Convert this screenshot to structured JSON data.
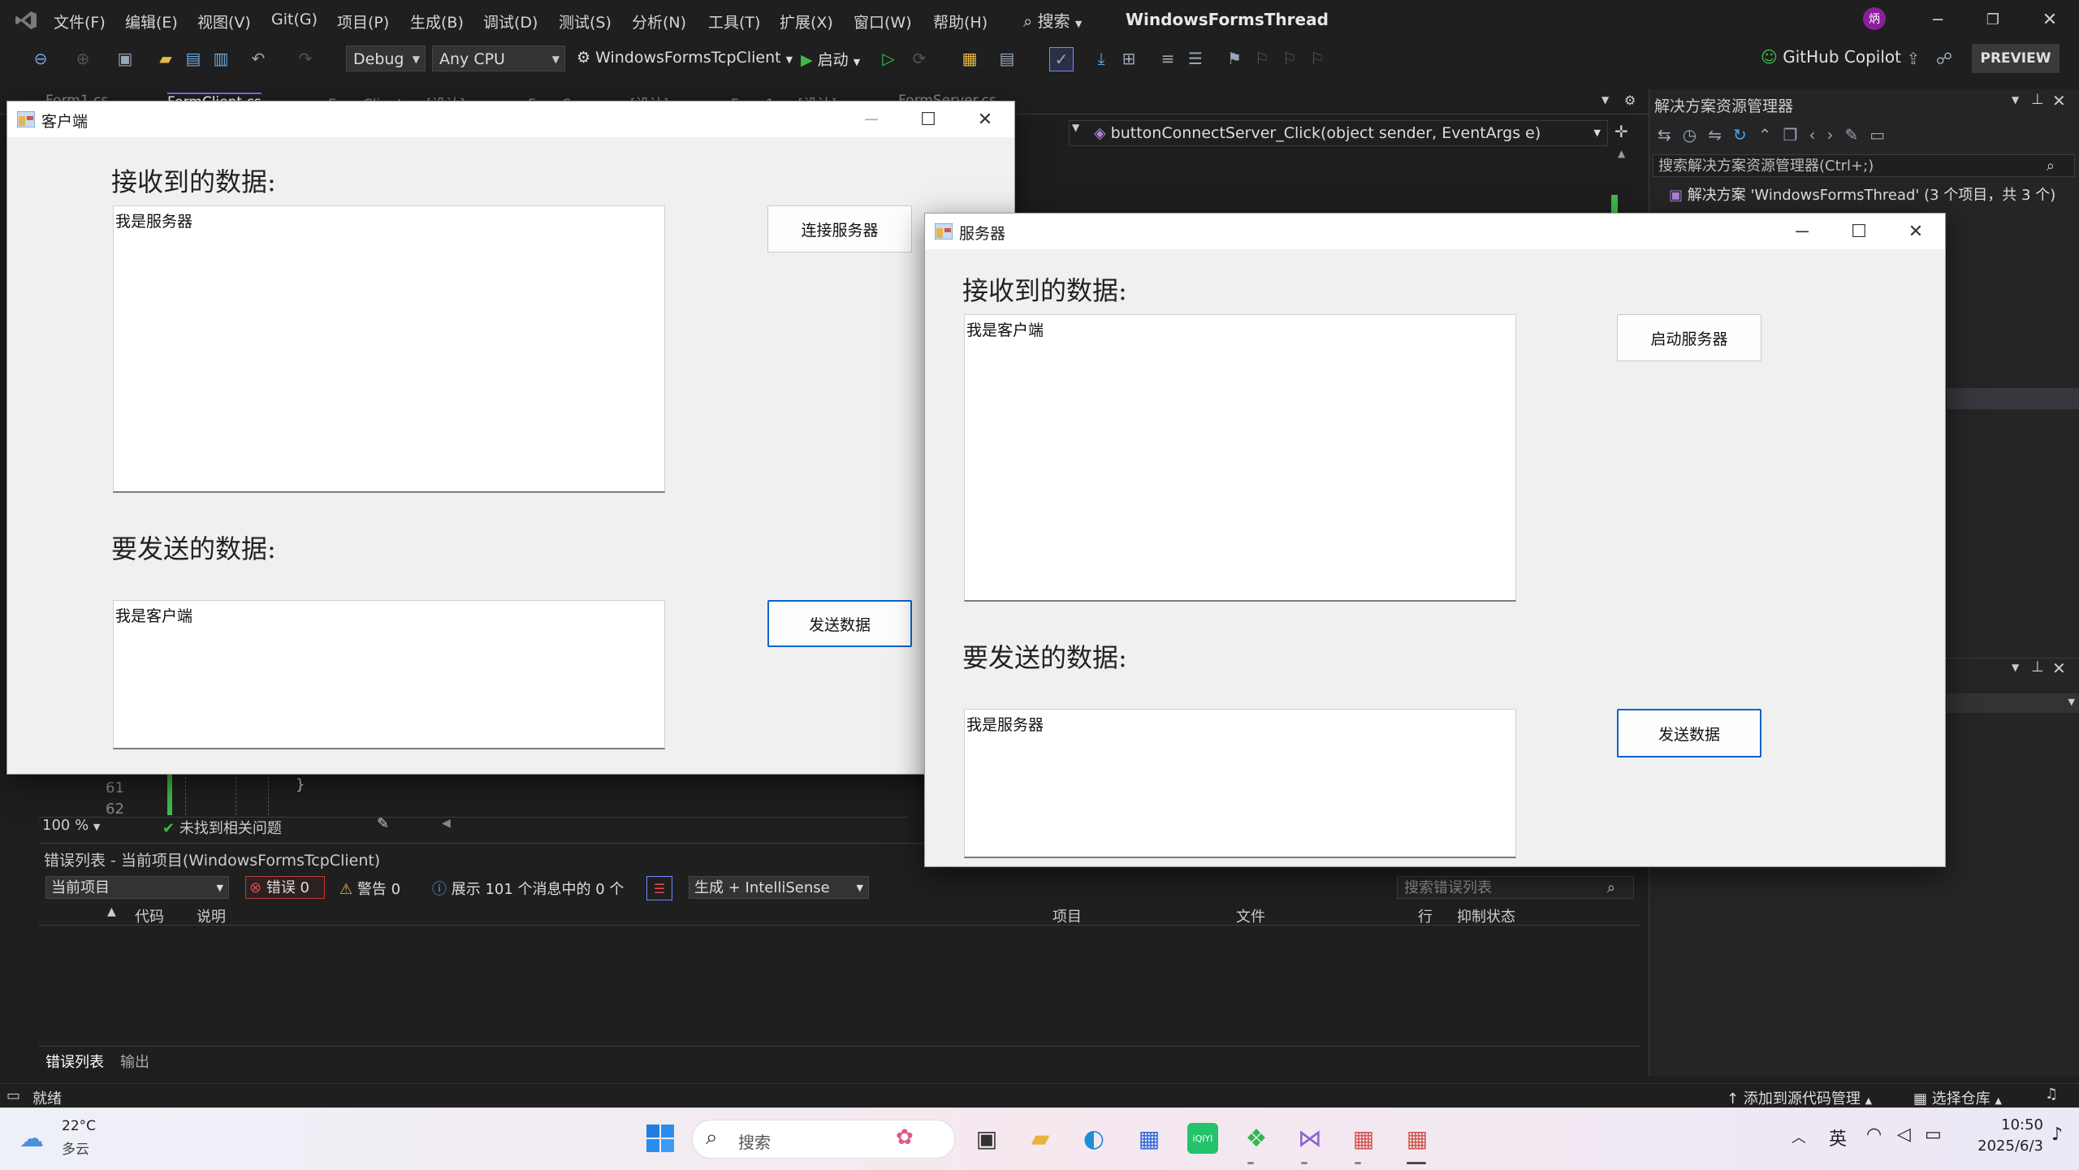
{
  "vs": {
    "menu": [
      "文件(F)",
      "编辑(E)",
      "视图(V)",
      "Git(G)",
      "项目(P)",
      "生成(B)",
      "调试(D)",
      "测试(S)",
      "分析(N)",
      "工具(T)",
      "扩展(X)",
      "窗口(W)",
      "帮助(H)"
    ],
    "search_label": "搜索",
    "solution_title": "WindowsFormsThread",
    "avatar_letter": "炳",
    "config": "Debug",
    "platform": "Any CPU",
    "startup_project": "WindowsFormsTcpClient",
    "start_label": "启动",
    "copilot": "GitHub Copilot",
    "preview": "PREVIEW",
    "tabs": [
      "Form1.cs",
      "FormClient.cs",
      "FormClient.cs [设计]",
      "FormServer.cs [设计]",
      "Form1.cs [设计]",
      "FormServer.cs"
    ],
    "member_dropdown": "buttonConnectServer_Click(object sender, EventArgs e)",
    "line_numbers": [
      "61",
      "62"
    ],
    "code_brace": "}",
    "zoom": "100 %",
    "no_issues": "未找到相关问题"
  },
  "solution_explorer": {
    "title": "解决方案资源管理器",
    "search_placeholder": "搜索解决方案资源管理器(Ctrl+;)",
    "root": "解决方案 'WindowsFormsThread' (3 个项目，共 3 个)"
  },
  "error_list": {
    "title": "错误列表 - 当前项目(WindowsFormsTcpClient)",
    "scope": "当前项目",
    "errors": "错误 0",
    "warnings": "警告 0",
    "messages": "展示 101 个消息中的 0 个",
    "build_filter": "生成 + IntelliSense",
    "search_placeholder": "搜索错误列表",
    "columns": [
      "代码",
      "说明",
      "项目",
      "文件",
      "行",
      "抑制状态"
    ],
    "bottom_tabs": [
      "错误列表",
      "输出"
    ]
  },
  "status": {
    "ready": "就绪",
    "add_source": "添加到源代码管理",
    "select_repo": "选择仓库"
  },
  "taskbar": {
    "temp": "22°C",
    "weather": "多云",
    "search": "搜索",
    "ime": "英",
    "time": "10:50",
    "date": "2025/6/3"
  },
  "client_form": {
    "title": "客户端",
    "recv_label": "接收到的数据:",
    "recv_text": "我是服务器",
    "send_label": "要发送的数据:",
    "send_text": "我是客户端",
    "connect_button": "连接服务器",
    "send_button": "发送数据"
  },
  "server_form": {
    "title": "服务器",
    "recv_label": "接收到的数据:",
    "recv_text": "我是客户端",
    "send_label": "要发送的数据:",
    "send_text": "我是服务器",
    "start_button": "启动服务器",
    "send_button": "发送数据"
  }
}
